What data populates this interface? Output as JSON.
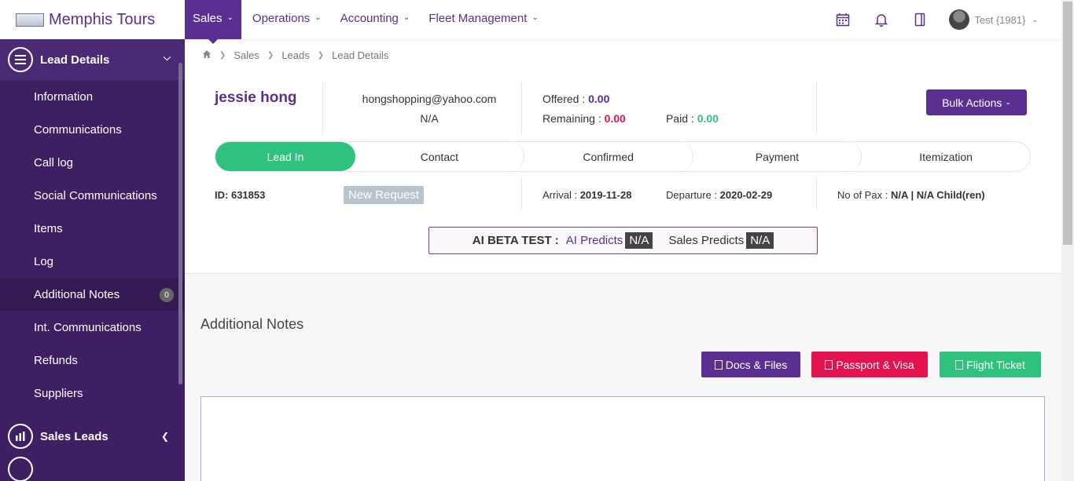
{
  "app": {
    "name": "Memphis Tours"
  },
  "nav": {
    "items": [
      {
        "label": "Sales"
      },
      {
        "label": "Operations"
      },
      {
        "label": "Accounting"
      },
      {
        "label": "Fleet Management"
      }
    ],
    "user": "Test {1981}"
  },
  "sidebar": {
    "header": "Lead Details",
    "items": [
      {
        "label": "Information"
      },
      {
        "label": "Communications"
      },
      {
        "label": "Call log"
      },
      {
        "label": "Social Communications"
      },
      {
        "label": "Items"
      },
      {
        "label": "Log"
      },
      {
        "label": "Additional Notes",
        "badge": "0"
      },
      {
        "label": "Int. Communications"
      },
      {
        "label": "Refunds"
      },
      {
        "label": "Suppliers"
      }
    ],
    "section2": "Sales Leads"
  },
  "breadcrumb": [
    "Sales",
    "Leads",
    "Lead Details"
  ],
  "lead": {
    "name": "jessie hong",
    "email": "hongshopping@yahoo.com",
    "phone": "N/A",
    "offered_label": "Offered :",
    "offered": "0.00",
    "remaining_label": "Remaining :",
    "remaining": "0.00",
    "paid_label": "Paid :",
    "paid": "0.00",
    "bulk_actions": "Bulk Actions",
    "id_label": "ID:",
    "id": "631853",
    "status": "New Request",
    "arrival_label": "Arrival :",
    "arrival": "2019-11-28",
    "departure_label": "Departure :",
    "departure": "2020-02-29",
    "pax_label": "No of Pax :",
    "pax": "N/A | N/A Child(ren)"
  },
  "steps": [
    "Lead In",
    "Contact",
    "Confirmed",
    "Payment",
    "Itemization"
  ],
  "ai": {
    "label": "AI BETA TEST :",
    "ai_predicts": "AI Predicts",
    "ai_value": "N/A",
    "sales_predicts": "Sales Predicts",
    "sales_value": "N/A"
  },
  "notes": {
    "title": "Additional Notes",
    "docs_button": "Docs & Files",
    "passport_button": "Passport & Visa",
    "flight_button": "Flight Ticket"
  },
  "colors": {
    "brand": "#5b2f91",
    "sidebar": "#3e1f64",
    "success": "#2ec27e",
    "danger": "#e4134f"
  }
}
